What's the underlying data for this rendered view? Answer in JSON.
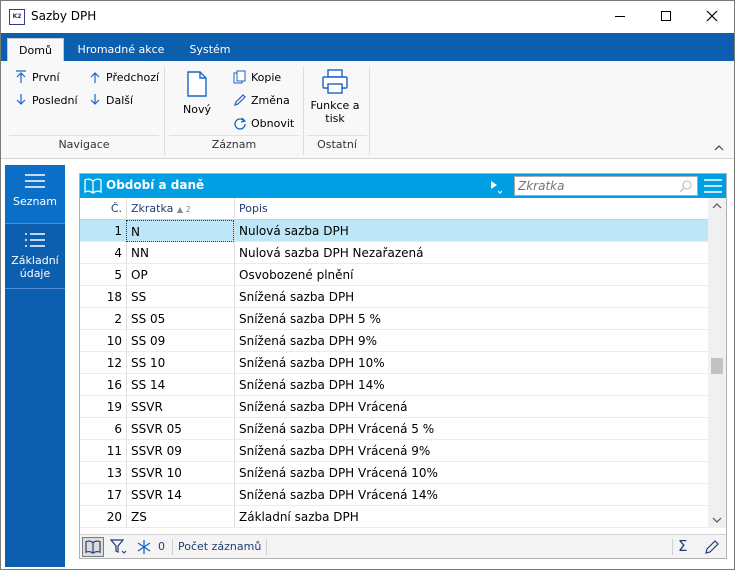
{
  "window": {
    "title": "Sazby DPH",
    "icon_text": "K2"
  },
  "ribbon": {
    "tabs": [
      {
        "label": "Domů",
        "active": true
      },
      {
        "label": "Hromadné akce",
        "active": false
      },
      {
        "label": "Systém",
        "active": false
      }
    ],
    "groups": {
      "navigace": {
        "label": "Navigace",
        "buttons": {
          "prvni": "První",
          "predchozi": "Předchozí",
          "posledni": "Poslední",
          "dalsi": "Další"
        }
      },
      "zaznam": {
        "label": "Záznam",
        "buttons": {
          "novy": "Nový",
          "kopie": "Kopie",
          "zmena": "Změna",
          "obnovit": "Obnovit"
        }
      },
      "ostatni": {
        "label": "Ostatní",
        "buttons": {
          "funkce_line1": "Funkce a",
          "funkce_line2": "tisk"
        }
      }
    }
  },
  "sidenav": {
    "items": [
      {
        "label": "Seznam",
        "active": true
      },
      {
        "label_line1": "Základní",
        "label_line2": "údaje",
        "active": false
      }
    ]
  },
  "panel": {
    "title": "Období a daně",
    "search": {
      "placeholder": "Zkratka",
      "value": ""
    },
    "columns": {
      "num": "Č.",
      "code": "Zkratka",
      "code_sort": "▲ 2",
      "desc": "Popis"
    },
    "rows": [
      {
        "num": "1",
        "code": "N",
        "desc": "Nulová sazba DPH",
        "selected": true
      },
      {
        "num": "4",
        "code": "NN",
        "desc": "Nulová sazba DPH Nezařazená"
      },
      {
        "num": "5",
        "code": "OP",
        "desc": "Osvobozené plnění"
      },
      {
        "num": "18",
        "code": "SS",
        "desc": "Snížená sazba DPH"
      },
      {
        "num": "2",
        "code": "SS 05",
        "desc": "Snížená sazba DPH 5 %"
      },
      {
        "num": "10",
        "code": "SS 09",
        "desc": "Snížená sazba DPH 9%"
      },
      {
        "num": "12",
        "code": "SS 10",
        "desc": "Snížená sazba DPH 10%"
      },
      {
        "num": "16",
        "code": "SS 14",
        "desc": "Snížená sazba DPH 14%"
      },
      {
        "num": "19",
        "code": "SSVR",
        "desc": "Snížená sazba DPH Vrácená"
      },
      {
        "num": "6",
        "code": "SSVR 05",
        "desc": "Snížená sazba DPH Vrácená 5 %"
      },
      {
        "num": "11",
        "code": "SSVR 09",
        "desc": "Snížená sazba DPH Vrácená 9%"
      },
      {
        "num": "13",
        "code": "SSVR 10",
        "desc": "Snížená sazba DPH Vrácená 10%"
      },
      {
        "num": "17",
        "code": "SSVR 14",
        "desc": "Snížená sazba DPH Vrácená 14%"
      },
      {
        "num": "20",
        "code": "ZS",
        "desc": "Základní sazba DPH"
      }
    ],
    "footer": {
      "filter_count": "0",
      "count_label": "Počet záznamů",
      "sigma": "Σ"
    }
  },
  "colors": {
    "ribbon_blue": "#0b5fae",
    "panel_header": "#009fe3",
    "selected_row": "#bde7f8",
    "icon_blue": "#1a64c4"
  },
  "icons": {
    "prvni": "arrow-up-bar-icon",
    "posledni": "arrow-down-icon",
    "predchozi": "arrow-up-icon",
    "dalsi": "arrow-down-icon",
    "novy": "new-document-icon",
    "kopie": "copy-icon",
    "zmena": "pencil-icon",
    "obnovit": "refresh-icon",
    "funkce": "printer-icon",
    "seznam": "list-icon",
    "zakladni": "details-list-icon",
    "panel": "book-icon",
    "search": "search-icon",
    "menu": "hamburger-icon",
    "filter": "filter-icon",
    "snow": "snowflake-icon",
    "edit": "pencil-icon"
  }
}
